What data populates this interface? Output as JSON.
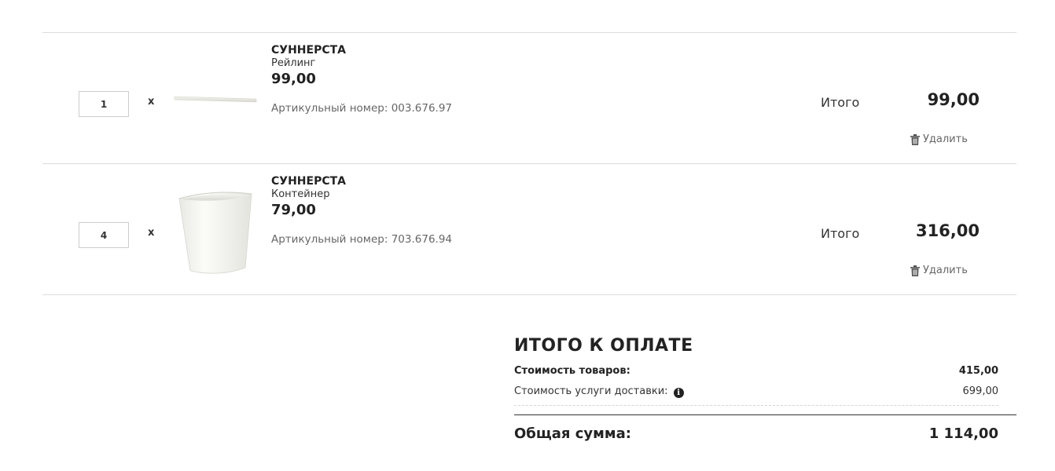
{
  "cart": {
    "items": [
      {
        "quantity": "1",
        "times_symbol": "x",
        "name": "СУННЕРСТА",
        "description": "Рейлинг",
        "price": "99,00",
        "article": "Артикульный номер: 003.676.97",
        "total_label": "Итого",
        "total": "99,00",
        "delete_label": "Удалить",
        "image": "rail-image"
      },
      {
        "quantity": "4",
        "times_symbol": "x",
        "name": "СУННЕРСТА",
        "description": "Контейнер",
        "price": "79,00",
        "article": "Артикульный номер: 703.676.94",
        "total_label": "Итого",
        "total": "316,00",
        "delete_label": "Удалить",
        "image": "container-image"
      }
    ]
  },
  "summary": {
    "title": "ИТОГО К ОПЛАТЕ",
    "goods_label": "Стоимость товаров:",
    "goods_value": "415,00",
    "delivery_label": "Стоимость услуги доставки:",
    "delivery_value": "699,00",
    "grand_label": "Общая сумма:",
    "grand_value": "1 114,00"
  },
  "icons": {
    "trash": "trash-icon",
    "info": "info-icon"
  }
}
